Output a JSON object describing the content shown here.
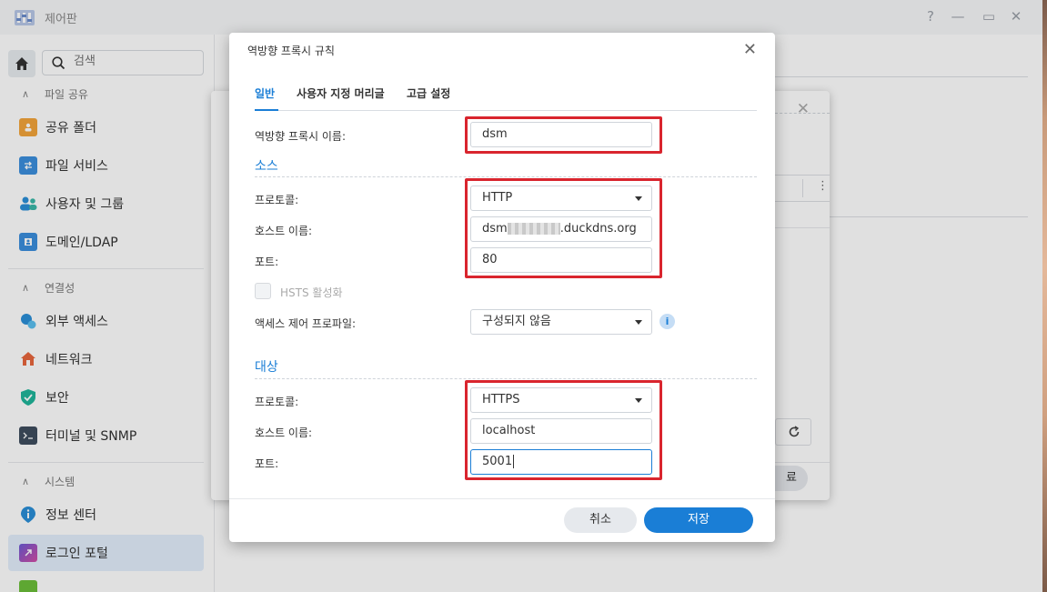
{
  "window": {
    "title": "제어판",
    "controls": {
      "help": "?",
      "minimize": "—",
      "maximize": "▭",
      "close": "✕"
    }
  },
  "sidebar": {
    "search_placeholder": "검색",
    "sections": [
      {
        "title": "파일 공유",
        "items": [
          {
            "label": "공유 폴더",
            "icon": "folder-share-icon"
          },
          {
            "label": "파일 서비스",
            "icon": "file-services-icon"
          },
          {
            "label": "사용자 및 그룹",
            "icon": "users-icon"
          },
          {
            "label": "도메인/LDAP",
            "icon": "domain-icon"
          }
        ]
      },
      {
        "title": "연결성",
        "items": [
          {
            "label": "외부 액세스",
            "icon": "external-access-icon"
          },
          {
            "label": "네트워크",
            "icon": "network-icon"
          },
          {
            "label": "보안",
            "icon": "shield-icon"
          },
          {
            "label": "터미널 및 SNMP",
            "icon": "terminal-icon"
          }
        ]
      },
      {
        "title": "시스템",
        "items": [
          {
            "label": "정보 센터",
            "icon": "info-center-icon"
          },
          {
            "label": "로그인 포털",
            "icon": "login-portal-icon",
            "active": true
          }
        ]
      }
    ]
  },
  "dialog": {
    "title": "역방향 프록시 규칙",
    "tabs": [
      "일반",
      "사용자 지정 머리글",
      "고급 설정"
    ],
    "name_label": "역방향 프록시 이름:",
    "name_value": "dsm",
    "source": {
      "title": "소스",
      "protocol_label": "프로토콜:",
      "protocol_value": "HTTP",
      "hostname_label": "호스트 이름:",
      "hostname_prefix": "dsm",
      "hostname_suffix": ".duckdns.org",
      "port_label": "포트:",
      "port_value": "80",
      "hsts_label": "HSTS 활성화",
      "acl_label": "액세스 제어 프로파일:",
      "acl_value": "구성되지 않음"
    },
    "destination": {
      "title": "대상",
      "protocol_label": "프로토콜:",
      "protocol_value": "HTTPS",
      "hostname_label": "호스트 이름:",
      "hostname_value": "localhost",
      "port_label": "포트:",
      "port_value": "5001"
    },
    "buttons": {
      "cancel": "취소",
      "save": "저장"
    }
  },
  "back_dialog": {
    "button_partial": "료"
  },
  "colors": {
    "accent": "#1a7ed6",
    "highlight_box": "#d9252e"
  }
}
